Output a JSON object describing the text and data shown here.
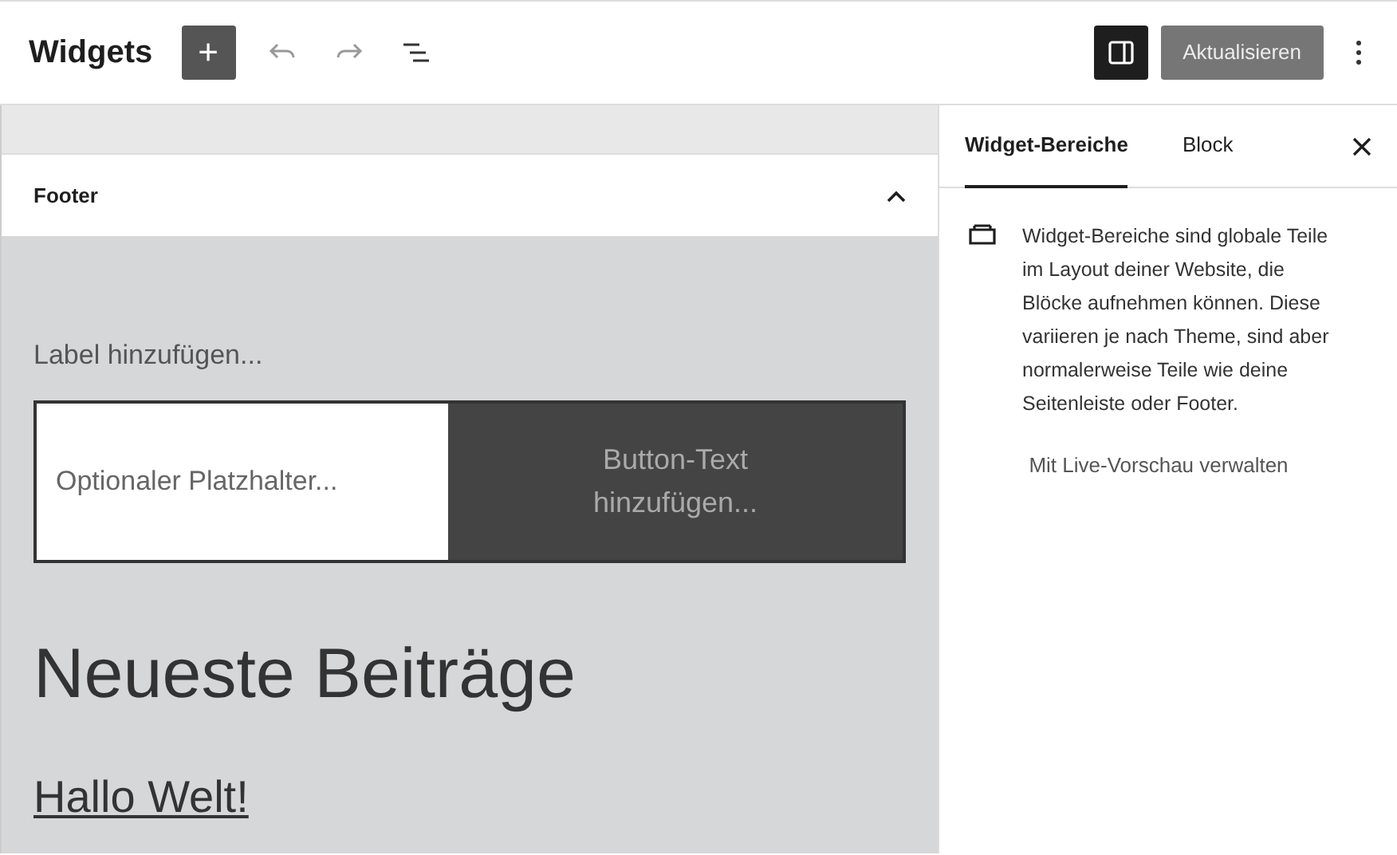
{
  "header": {
    "title": "Widgets",
    "add_button": "+",
    "sidebar_toggle": {
      "selected": true
    },
    "update_button": {
      "label": "Aktualisieren",
      "disabled": true
    }
  },
  "area": {
    "title": "Footer",
    "expanded": true
  },
  "search_block": {
    "label": "Label hinzufügen...",
    "placeholder": "Optionaler Platzhalter...",
    "button": "Button-Text hinzufügen..."
  },
  "latest_posts": {
    "heading": "Neueste Beiträge",
    "posts": [
      "Hallo Welt!"
    ]
  },
  "sidebar": {
    "tabs": [
      {
        "label": "Widget-Bereiche",
        "selected": true
      },
      {
        "label": "Block",
        "selected": false
      }
    ],
    "description": "Widget-Bereiche sind globale Teile im Layout deiner Website, die Blöcke aufnehmen können. Diese variieren je nach Theme, sind aber normalerweise Teile wie deine Seitenleiste oder Footer.",
    "link": "Mit Live-Vorschau verwalten"
  }
}
